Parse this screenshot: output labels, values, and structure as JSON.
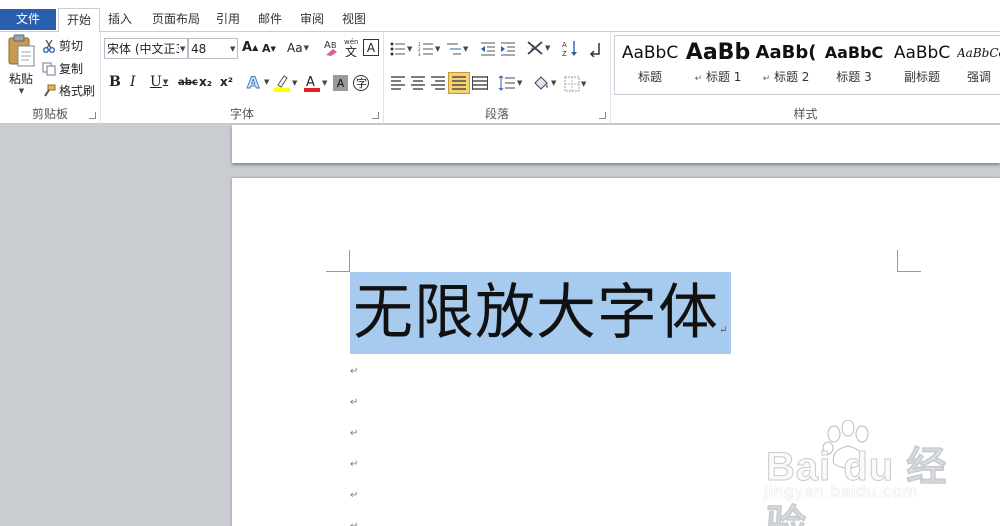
{
  "menu": {
    "tabs": [
      {
        "label": "文件"
      },
      {
        "label": "开始"
      },
      {
        "label": "插入"
      },
      {
        "label": "页面布局"
      },
      {
        "label": "引用"
      },
      {
        "label": "邮件"
      },
      {
        "label": "审阅"
      },
      {
        "label": "视图"
      }
    ]
  },
  "ribbon": {
    "clipboard": {
      "paste_label": "粘贴",
      "cut_label": "剪切",
      "copy_label": "复制",
      "format_painter_label": "格式刷",
      "group_label": "剪贴板"
    },
    "font": {
      "font_name": "宋体 (中文正3",
      "font_size": "48",
      "grow_label": "A",
      "shrink_label": "A",
      "case_label": "Aa",
      "bold_label": "B",
      "italic_label": "I",
      "underline_label": "U",
      "strike_label": "abc",
      "subscript_label": "x₂",
      "superscript_label": "x²",
      "highlight_color": "#ffff00",
      "font_color": "#e02020",
      "group_label": "字体"
    },
    "paragraph": {
      "group_label": "段落"
    },
    "styles": {
      "items": [
        {
          "sample": "AaBbC",
          "name": "标题"
        },
        {
          "sample": "AaBb",
          "name": "标题 1"
        },
        {
          "sample": "AaBb(",
          "name": "标题 2"
        },
        {
          "sample": "AaBbC",
          "name": "标题 3"
        },
        {
          "sample": "AaBbC",
          "name": "副标题"
        },
        {
          "sample": "AaBbCc",
          "name": "强调"
        }
      ],
      "group_label": "样式"
    }
  },
  "document": {
    "heading_text": "无限放大字体",
    "paragraph_mark": "↵",
    "selection_color": "#a6cbee"
  },
  "watermark": {
    "main": "Bai du 经验",
    "sub": "jingyan.baidu.com"
  }
}
